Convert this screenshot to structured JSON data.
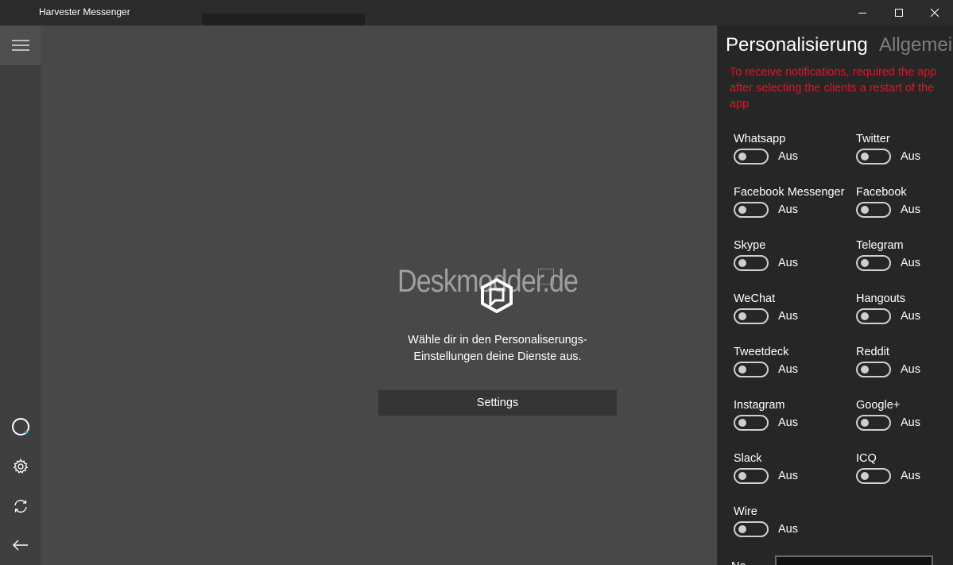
{
  "window": {
    "title": "Harvester Messenger"
  },
  "rail": {
    "icons": [
      "hamburger-menu-icon",
      "loading-ring-icon",
      "gear-icon",
      "refresh-icon",
      "back-arrow-icon"
    ]
  },
  "main": {
    "watermark": "Deskmodder.de",
    "message_line1": "Wähle dir in den Personaliserungs-",
    "message_line2": "Einstellungen deine Dienste aus.",
    "settings_label": "Settings"
  },
  "panel": {
    "tabs": [
      {
        "label": "Personalisierung",
        "active": true
      },
      {
        "label": "Allgemein",
        "active": false
      }
    ],
    "notice": "To receive notifications, required the app after selecting the clients a restart of the app",
    "notice_color": "#e81123",
    "clients": [
      {
        "name": "Whatsapp",
        "state": "Aus"
      },
      {
        "name": "Twitter",
        "state": "Aus"
      },
      {
        "name": "Facebook Messenger",
        "state": "Aus"
      },
      {
        "name": "Facebook",
        "state": "Aus"
      },
      {
        "name": "Skype",
        "state": "Aus"
      },
      {
        "name": "Telegram",
        "state": "Aus"
      },
      {
        "name": "WeChat",
        "state": "Aus"
      },
      {
        "name": "Hangouts",
        "state": "Aus"
      },
      {
        "name": "Tweetdeck",
        "state": "Aus"
      },
      {
        "name": "Reddit",
        "state": "Aus"
      },
      {
        "name": "Instagram",
        "state": "Aus"
      },
      {
        "name": "Google+",
        "state": "Aus"
      },
      {
        "name": "Slack",
        "state": "Aus"
      },
      {
        "name": "ICQ",
        "state": "Aus"
      },
      {
        "name": "Wire",
        "state": "Aus"
      }
    ],
    "name_label": "Na"
  },
  "colors": {
    "titlebar": "#2b2b2b",
    "rail": "#3f3f3f",
    "main": "#484848",
    "panel": "#262626",
    "accent": "#1fb7d6"
  }
}
